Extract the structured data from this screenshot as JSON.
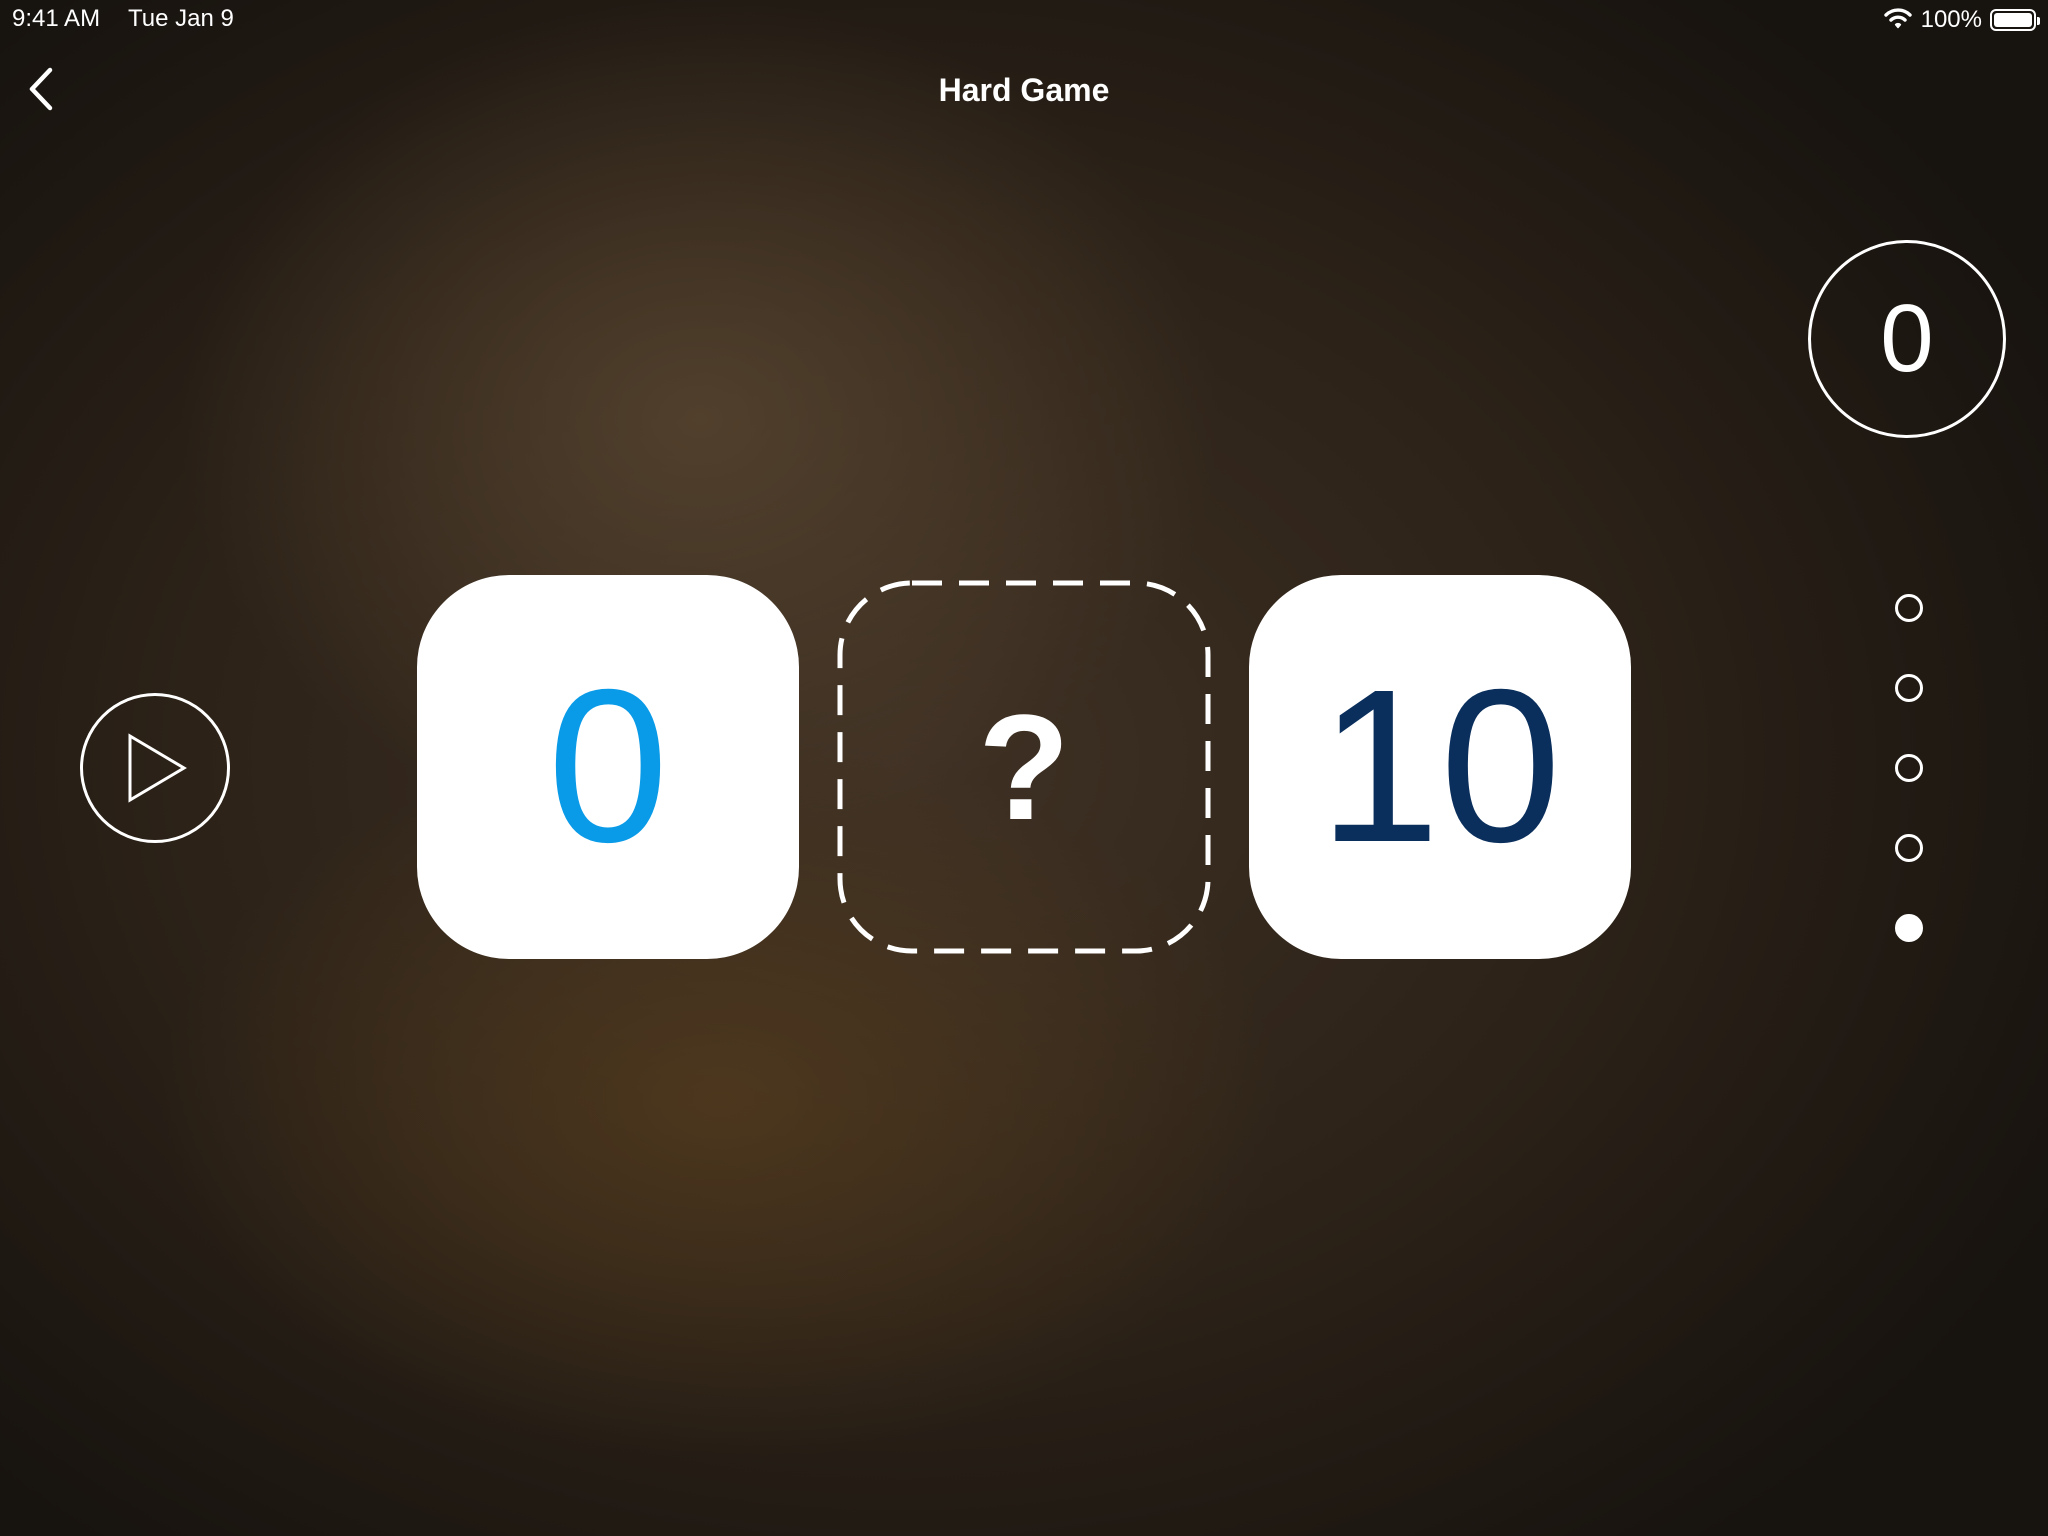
{
  "status_bar": {
    "time": "9:41 AM",
    "date": "Tue Jan 9",
    "battery_percent": "100%",
    "battery_level": 1.0,
    "icons": [
      "wifi-icon",
      "battery-icon"
    ]
  },
  "nav": {
    "title": "Hard Game",
    "back_icon": "chevron-left-icon"
  },
  "score": {
    "value": "0"
  },
  "play_button": {
    "icon": "play-icon"
  },
  "puzzle": {
    "left_number": "0",
    "answer_placeholder": "?",
    "right_number": "10",
    "left_color": "#0a9be8",
    "right_color": "#0a2f5c"
  },
  "progress": {
    "total": 5,
    "completed": 1,
    "states": [
      "empty",
      "empty",
      "empty",
      "empty",
      "filled"
    ]
  }
}
